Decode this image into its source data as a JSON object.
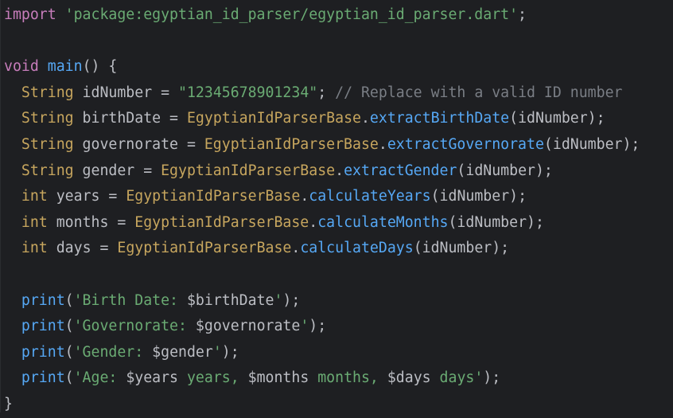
{
  "lines": [
    {
      "tokens": [
        {
          "t": "import",
          "c": "imp"
        },
        {
          "t": " ",
          "c": "pl"
        },
        {
          "t": "'package:egyptian_id_parser/egyptian_id_parser.dart'",
          "c": "str"
        },
        {
          "t": ";",
          "c": "pl"
        }
      ]
    },
    {
      "tokens": []
    },
    {
      "tokens": [
        {
          "t": "void",
          "c": "imp"
        },
        {
          "t": " ",
          "c": "pl"
        },
        {
          "t": "main",
          "c": "fn"
        },
        {
          "t": "() {",
          "c": "pl"
        }
      ]
    },
    {
      "tokens": [
        {
          "t": "  ",
          "c": "pl"
        },
        {
          "t": "String",
          "c": "type"
        },
        {
          "t": " idNumber = ",
          "c": "pl"
        },
        {
          "t": "\"12345678901234\"",
          "c": "str"
        },
        {
          "t": "; ",
          "c": "pl"
        },
        {
          "t": "// Replace with a valid ID number",
          "c": "cmt"
        }
      ]
    },
    {
      "tokens": [
        {
          "t": "  ",
          "c": "pl"
        },
        {
          "t": "String",
          "c": "type"
        },
        {
          "t": " birthDate = ",
          "c": "pl"
        },
        {
          "t": "EgyptianIdParserBase",
          "c": "cls"
        },
        {
          "t": ".",
          "c": "pl"
        },
        {
          "t": "extractBirthDate",
          "c": "fn"
        },
        {
          "t": "(idNumber);",
          "c": "pl"
        }
      ]
    },
    {
      "tokens": [
        {
          "t": "  ",
          "c": "pl"
        },
        {
          "t": "String",
          "c": "type"
        },
        {
          "t": " governorate = ",
          "c": "pl"
        },
        {
          "t": "EgyptianIdParserBase",
          "c": "cls"
        },
        {
          "t": ".",
          "c": "pl"
        },
        {
          "t": "extractGovernorate",
          "c": "fn"
        },
        {
          "t": "(idNumber);",
          "c": "pl"
        }
      ]
    },
    {
      "tokens": [
        {
          "t": "  ",
          "c": "pl"
        },
        {
          "t": "String",
          "c": "type"
        },
        {
          "t": " gender = ",
          "c": "pl"
        },
        {
          "t": "EgyptianIdParserBase",
          "c": "cls"
        },
        {
          "t": ".",
          "c": "pl"
        },
        {
          "t": "extractGender",
          "c": "fn"
        },
        {
          "t": "(idNumber);",
          "c": "pl"
        }
      ]
    },
    {
      "tokens": [
        {
          "t": "  ",
          "c": "pl"
        },
        {
          "t": "int",
          "c": "type"
        },
        {
          "t": " years = ",
          "c": "pl"
        },
        {
          "t": "EgyptianIdParserBase",
          "c": "cls"
        },
        {
          "t": ".",
          "c": "pl"
        },
        {
          "t": "calculateYears",
          "c": "fn"
        },
        {
          "t": "(idNumber);",
          "c": "pl"
        }
      ]
    },
    {
      "tokens": [
        {
          "t": "  ",
          "c": "pl"
        },
        {
          "t": "int",
          "c": "type"
        },
        {
          "t": " months = ",
          "c": "pl"
        },
        {
          "t": "EgyptianIdParserBase",
          "c": "cls"
        },
        {
          "t": ".",
          "c": "pl"
        },
        {
          "t": "calculateMonths",
          "c": "fn"
        },
        {
          "t": "(idNumber);",
          "c": "pl"
        }
      ]
    },
    {
      "tokens": [
        {
          "t": "  ",
          "c": "pl"
        },
        {
          "t": "int",
          "c": "type"
        },
        {
          "t": " days = ",
          "c": "pl"
        },
        {
          "t": "EgyptianIdParserBase",
          "c": "cls"
        },
        {
          "t": ".",
          "c": "pl"
        },
        {
          "t": "calculateDays",
          "c": "fn"
        },
        {
          "t": "(idNumber);",
          "c": "pl"
        }
      ]
    },
    {
      "tokens": []
    },
    {
      "tokens": [
        {
          "t": "  ",
          "c": "pl"
        },
        {
          "t": "print",
          "c": "fn"
        },
        {
          "t": "(",
          "c": "pl"
        },
        {
          "t": "'Birth Date: ",
          "c": "str"
        },
        {
          "t": "$birthDate",
          "c": "interp"
        },
        {
          "t": "'",
          "c": "str"
        },
        {
          "t": ");",
          "c": "pl"
        }
      ]
    },
    {
      "tokens": [
        {
          "t": "  ",
          "c": "pl"
        },
        {
          "t": "print",
          "c": "fn"
        },
        {
          "t": "(",
          "c": "pl"
        },
        {
          "t": "'Governorate: ",
          "c": "str"
        },
        {
          "t": "$governorate",
          "c": "interp"
        },
        {
          "t": "'",
          "c": "str"
        },
        {
          "t": ");",
          "c": "pl"
        }
      ]
    },
    {
      "tokens": [
        {
          "t": "  ",
          "c": "pl"
        },
        {
          "t": "print",
          "c": "fn"
        },
        {
          "t": "(",
          "c": "pl"
        },
        {
          "t": "'Gender: ",
          "c": "str"
        },
        {
          "t": "$gender",
          "c": "interp"
        },
        {
          "t": "'",
          "c": "str"
        },
        {
          "t": ");",
          "c": "pl"
        }
      ]
    },
    {
      "tokens": [
        {
          "t": "  ",
          "c": "pl"
        },
        {
          "t": "print",
          "c": "fn"
        },
        {
          "t": "(",
          "c": "pl"
        },
        {
          "t": "'Age: ",
          "c": "str"
        },
        {
          "t": "$years",
          "c": "interp"
        },
        {
          "t": " years, ",
          "c": "str"
        },
        {
          "t": "$months",
          "c": "interp"
        },
        {
          "t": " months, ",
          "c": "str"
        },
        {
          "t": "$days",
          "c": "interp"
        },
        {
          "t": " days'",
          "c": "str"
        },
        {
          "t": ");",
          "c": "pl"
        }
      ]
    },
    {
      "tokens": [
        {
          "t": "}",
          "c": "pl"
        }
      ]
    }
  ],
  "colors": {
    "background": "#1e1f22",
    "default_text": "#bcbec4",
    "keyword": "#c77dbb",
    "string": "#6aab73",
    "function": "#56a8f5",
    "class": "#c7a65e",
    "comment": "#7a7e85"
  }
}
